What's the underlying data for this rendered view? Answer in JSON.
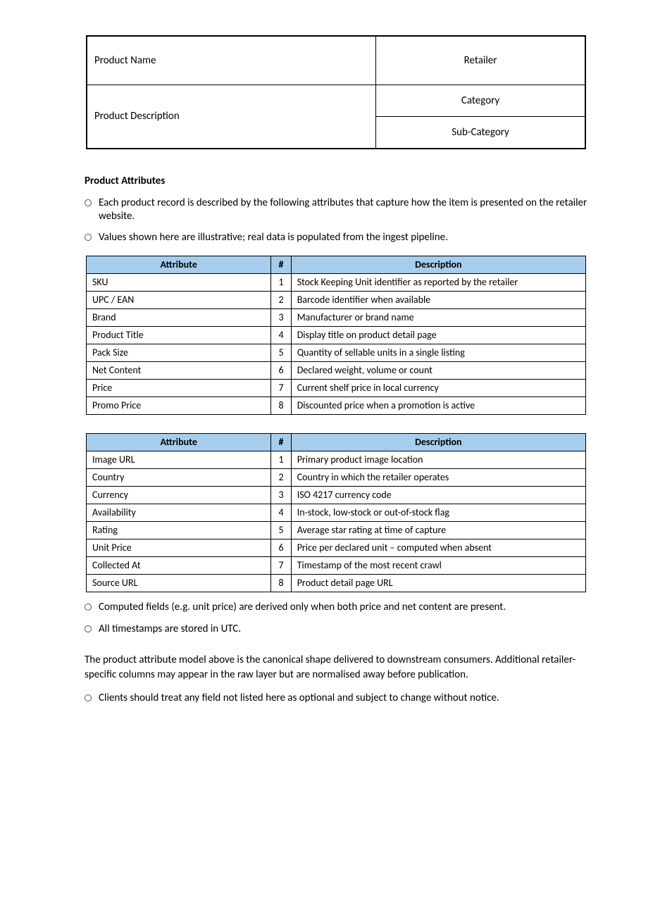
{
  "top_table": {
    "left1": "Product Name",
    "right1": "Retailer",
    "left2": "Product Description",
    "right2a": "Category",
    "right2b": "Sub-Category"
  },
  "heading": "Product Attributes",
  "bullets_a": [
    "Each product record is described by the following attributes that capture how the item is presented on the retailer website.",
    "Values shown here are illustrative; real data is populated from the ingest pipeline."
  ],
  "table1": {
    "head": {
      "attr": "Attribute",
      "num": "#",
      "desc": "Description"
    },
    "rows": [
      {
        "name": "SKU",
        "n": "1",
        "desc": "Stock Keeping Unit identifier as reported by the retailer"
      },
      {
        "name": "UPC / EAN",
        "n": "2",
        "desc": "Barcode identifier when available"
      },
      {
        "name": "Brand",
        "n": "3",
        "desc": "Manufacturer or brand name"
      },
      {
        "name": "Product Title",
        "n": "4",
        "desc": "Display title on product detail page"
      },
      {
        "name": "Pack Size",
        "n": "5",
        "desc": "Quantity of sellable units in a single listing"
      },
      {
        "name": "Net Content",
        "n": "6",
        "desc": "Declared weight, volume or count"
      },
      {
        "name": "Price",
        "n": "7",
        "desc": "Current shelf price in local currency"
      },
      {
        "name": "Promo Price",
        "n": "8",
        "desc": "Discounted price when a promotion is active"
      }
    ]
  },
  "table2": {
    "head": {
      "attr": "Attribute",
      "num": "#",
      "desc": "Description"
    },
    "rows": [
      {
        "name": "Image URL",
        "n": "1",
        "desc": "Primary product image location"
      },
      {
        "name": "Country",
        "n": "2",
        "desc": "Country in which the retailer operates"
      },
      {
        "name": "Currency",
        "n": "3",
        "desc": "ISO 4217 currency code"
      },
      {
        "name": "Availability",
        "n": "4",
        "desc": "In-stock, low-stock or out-of-stock flag"
      },
      {
        "name": "Rating",
        "n": "5",
        "desc": "Average star rating at time of capture"
      },
      {
        "name": "Unit Price",
        "n": "6",
        "desc": "Price per declared unit – computed when absent"
      },
      {
        "name": "Collected At",
        "n": "7",
        "desc": "Timestamp of the most recent crawl"
      },
      {
        "name": "Source URL",
        "n": "8",
        "desc": "Product detail page URL"
      }
    ]
  },
  "bullets_b": [
    "Computed fields (e.g. unit price) are derived only when both price and net content are present.",
    "All timestamps are stored in UTC."
  ],
  "para": "The product attribute model above is the canonical shape delivered to downstream consumers. Additional retailer-specific columns may appear in the raw layer but are normalised away before publication.",
  "bullets_c": [
    "Clients should treat any field not listed here as optional and subject to change without notice."
  ]
}
